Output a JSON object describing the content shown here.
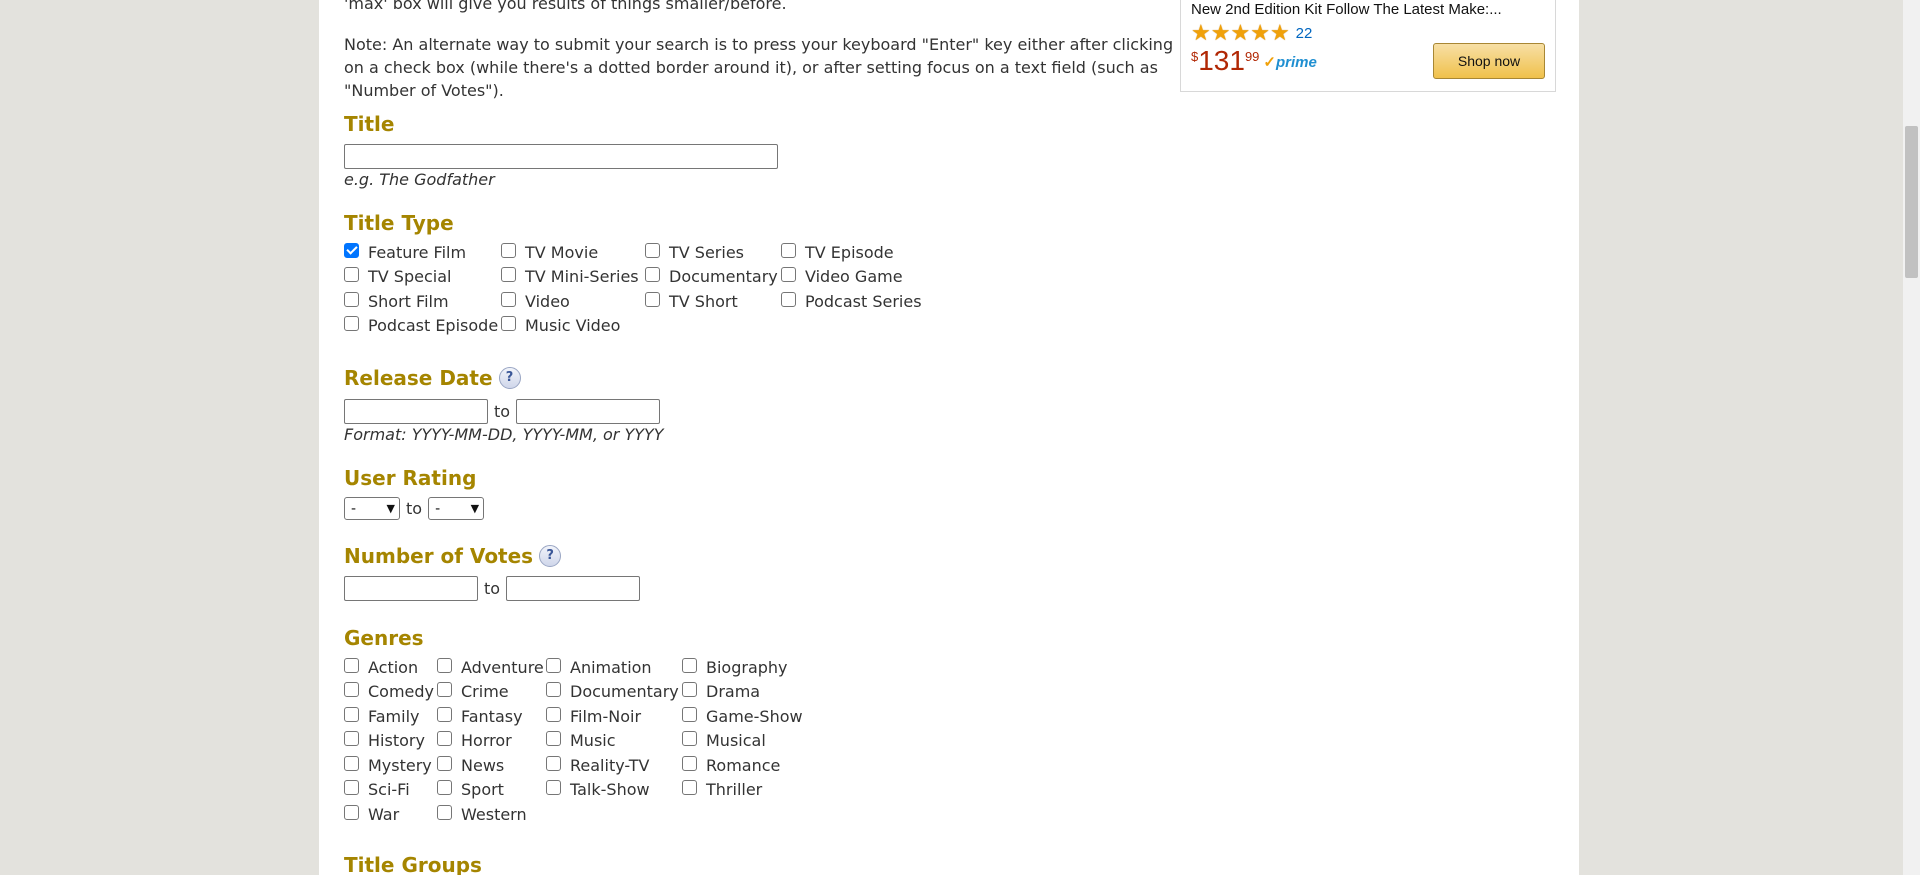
{
  "intro": {
    "line1": "'max' box will give you results of things smaller/before.",
    "note": "Note: An alternate way to submit your search is to press your keyboard \"Enter\" key either after clicking on a check box (while there's a dotted border around it), or after setting focus on a text field (such as \"Number of Votes\")."
  },
  "title_section": {
    "heading": "Title",
    "input_value": "",
    "hint_prefix": "e.g. ",
    "hint_example": "The Godfather"
  },
  "title_type": {
    "heading": "Title Type",
    "options": [
      {
        "label": "Feature Film",
        "checked": true
      },
      {
        "label": "TV Movie",
        "checked": false
      },
      {
        "label": "TV Series",
        "checked": false
      },
      {
        "label": "TV Episode",
        "checked": false
      },
      {
        "label": "TV Special",
        "checked": false
      },
      {
        "label": "TV Mini-Series",
        "checked": false
      },
      {
        "label": "Documentary",
        "checked": false
      },
      {
        "label": "Video Game",
        "checked": false
      },
      {
        "label": "Short Film",
        "checked": false
      },
      {
        "label": "Video",
        "checked": false
      },
      {
        "label": "TV Short",
        "checked": false
      },
      {
        "label": "Podcast Series",
        "checked": false
      },
      {
        "label": "Podcast Episode",
        "checked": false
      },
      {
        "label": "Music Video",
        "checked": false
      }
    ]
  },
  "release_date": {
    "heading": "Release Date",
    "help": "?",
    "from_value": "",
    "to_label": "to",
    "to_value": "",
    "format_hint": "Format: YYYY-MM-DD, YYYY-MM, or YYYY"
  },
  "user_rating": {
    "heading": "User Rating",
    "min_selected": "-",
    "to_label": "to",
    "max_selected": "-"
  },
  "num_votes": {
    "heading": "Number of Votes",
    "help": "?",
    "min_value": "",
    "to_label": "to",
    "max_value": ""
  },
  "genres": {
    "heading": "Genres",
    "options": [
      {
        "label": "Action",
        "checked": false
      },
      {
        "label": "Adventure",
        "checked": false
      },
      {
        "label": "Animation",
        "checked": false
      },
      {
        "label": "Biography",
        "checked": false
      },
      {
        "label": "Comedy",
        "checked": false
      },
      {
        "label": "Crime",
        "checked": false
      },
      {
        "label": "Documentary",
        "checked": false
      },
      {
        "label": "Drama",
        "checked": false
      },
      {
        "label": "Family",
        "checked": false
      },
      {
        "label": "Fantasy",
        "checked": false
      },
      {
        "label": "Film-Noir",
        "checked": false
      },
      {
        "label": "Game-Show",
        "checked": false
      },
      {
        "label": "History",
        "checked": false
      },
      {
        "label": "Horror",
        "checked": false
      },
      {
        "label": "Music",
        "checked": false
      },
      {
        "label": "Musical",
        "checked": false
      },
      {
        "label": "Mystery",
        "checked": false
      },
      {
        "label": "News",
        "checked": false
      },
      {
        "label": "Reality-TV",
        "checked": false
      },
      {
        "label": "Romance",
        "checked": false
      },
      {
        "label": "Sci-Fi",
        "checked": false
      },
      {
        "label": "Sport",
        "checked": false
      },
      {
        "label": "Talk-Show",
        "checked": false
      },
      {
        "label": "Thriller",
        "checked": false
      },
      {
        "label": "War",
        "checked": false
      },
      {
        "label": "Western",
        "checked": false
      }
    ]
  },
  "title_groups": {
    "heading": "Title Groups"
  },
  "ad": {
    "product_title": "New 2nd Edition Kit Follow The Latest Make:...",
    "stars": 5,
    "review_count": "22",
    "price_currency": "$",
    "price_whole": "131",
    "price_cents": "99",
    "prime_label": "prime",
    "prime_check": "✓",
    "cta": "Shop now",
    "star_color": "#f0a10a",
    "price_color": "#b12704"
  },
  "colors": {
    "heading": "#a58500",
    "checkbox_checked": "#0075ff",
    "page_bg": "#e3e2dd"
  }
}
